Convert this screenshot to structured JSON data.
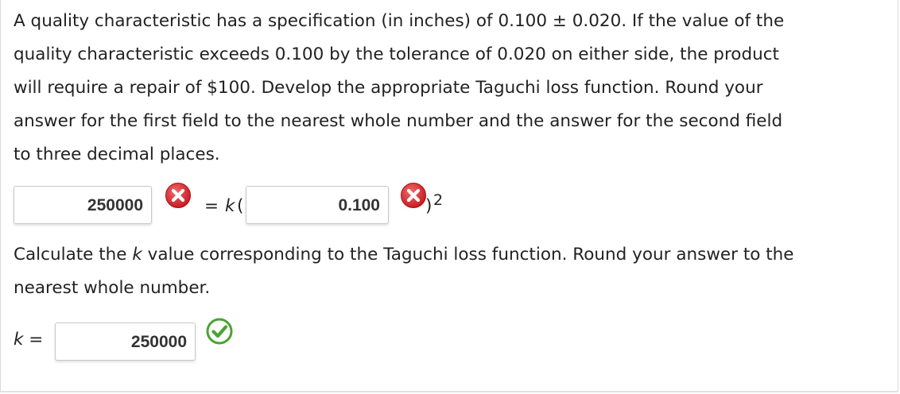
{
  "problem": {
    "line1": "A quality characteristic has a specification (in inches) of 0.100 ± 0.020. If the value of the",
    "line2": "quality characteristic exceeds 0.100 by the tolerance of 0.020 on either side, the product",
    "line3": "will require a repair of $100. Develop the appropriate Taguchi loss function. Round your",
    "line4": "answer for the first field to the nearest whole number and the answer for the second field",
    "line5": "to three decimal places."
  },
  "equation": {
    "field1_value": "250000",
    "field1_status": "incorrect",
    "equals_text": "= ",
    "k_symbol": "k",
    "open_paren": "(",
    "field2_value": "0.100",
    "field2_status": "incorrect",
    "close_paren": ")",
    "exponent": "2"
  },
  "k_question": {
    "line1_pre": "Calculate the ",
    "line1_k": "k",
    "line1_post": " value corresponding to the Taguchi loss function. Round your answer to the",
    "line2": "nearest whole number."
  },
  "k_answer": {
    "label_k": "k",
    "label_eq": " =",
    "value": "250000",
    "status": "correct"
  },
  "colors": {
    "incorrect": "#d9252b",
    "correct": "#4aa332",
    "text": "#222222"
  },
  "icons": {
    "incorrect": "x-circle-icon",
    "correct": "check-circle-icon"
  }
}
